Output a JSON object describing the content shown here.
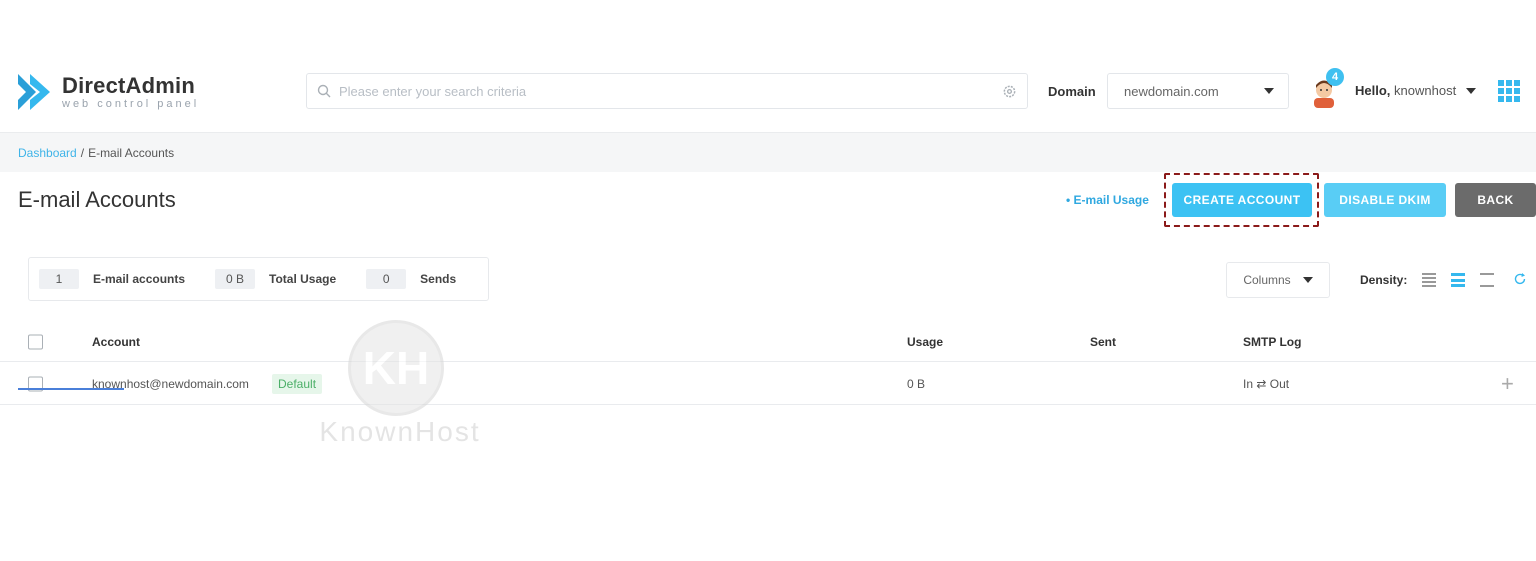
{
  "brand": {
    "title": "DirectAdmin",
    "subtitle": "web control panel",
    "accent_color": "#3cc2f3"
  },
  "header": {
    "search_placeholder": "Please enter your search criteria",
    "domain_label": "Domain",
    "domain_value": "newdomain.com",
    "notification_count": "4",
    "hello_prefix": "Hello,",
    "username": "knownhost"
  },
  "breadcrumb": {
    "home": "Dashboard",
    "separator": "/",
    "current": "E-mail Accounts"
  },
  "page": {
    "title": "E-mail Accounts",
    "usage_link": "• E-mail Usage",
    "buttons": {
      "create": "CREATE ACCOUNT",
      "dkim": "DISABLE DKIM",
      "back": "BACK"
    }
  },
  "stats": [
    {
      "value": "1",
      "label": "E-mail accounts"
    },
    {
      "value": "0 B",
      "label": "Total Usage"
    },
    {
      "value": "0",
      "label": "Sends"
    }
  ],
  "toolbar": {
    "columns_label": "Columns",
    "density_label": "Density:"
  },
  "table": {
    "headers": [
      "Account",
      "Usage",
      "Sent",
      "SMTP Log"
    ],
    "rows": [
      {
        "account": "knownhost@newdomain.com",
        "badge": "Default",
        "usage": "0 B",
        "sent": "",
        "smtp_log": "In ⇄ Out"
      }
    ]
  },
  "watermark": {
    "letters": "KH",
    "text": "KnownHost"
  }
}
